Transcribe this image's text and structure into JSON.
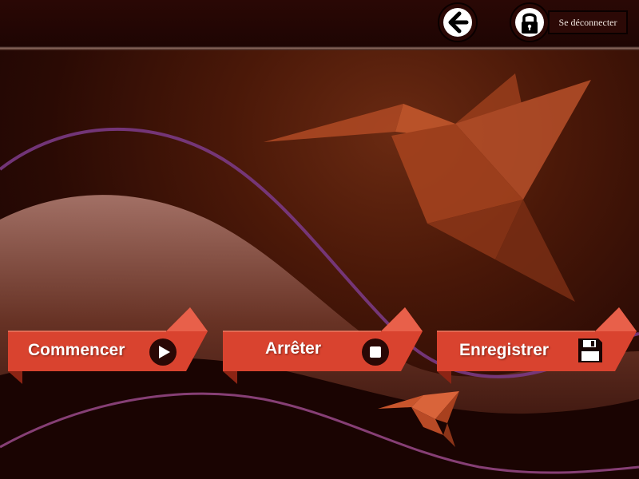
{
  "header": {
    "back_icon": "arrow-left-icon",
    "lock_icon": "padlock-icon",
    "logout_label": "Se déconnecter"
  },
  "actions": [
    {
      "label": "Commencer",
      "icon": "play-icon"
    },
    {
      "label": "Arrêter",
      "icon": "stop-icon"
    },
    {
      "label": "Enregistrer",
      "icon": "floppy-disk-icon"
    }
  ],
  "colors": {
    "ribbon": "#d9432f",
    "ribbon_dark": "#8c2414",
    "background": "#3a0f06",
    "accent_line": "#8a3a8a"
  }
}
